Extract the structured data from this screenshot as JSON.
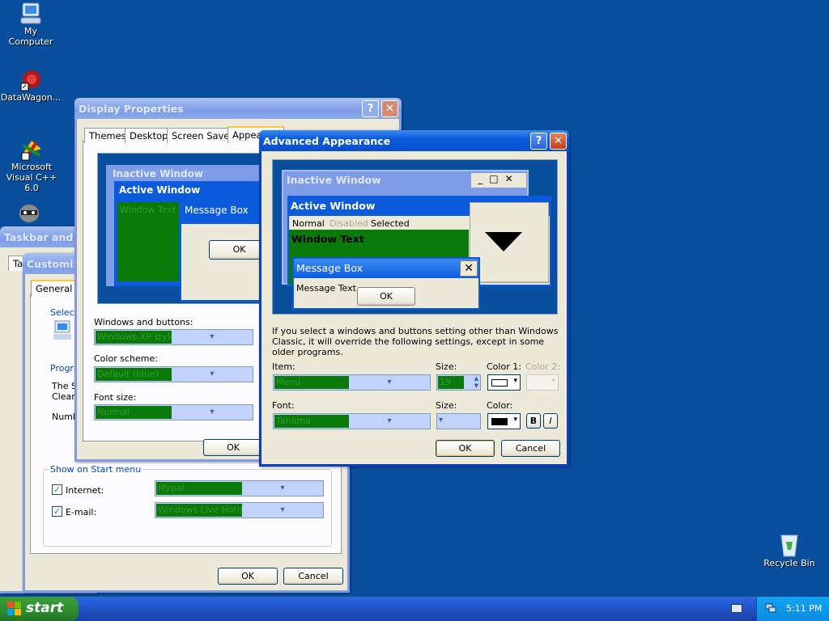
{
  "desktop": {
    "icons": [
      {
        "label": "My Computer",
        "icon": "computer-icon"
      },
      {
        "label": "DataWagon...",
        "icon": "datawagon-icon"
      },
      {
        "label": "Microsoft Visual C++ 6.0",
        "icon": "visual-cpp-icon"
      },
      {
        "label": "",
        "icon": "raccoon-icon"
      },
      {
        "label": "Recycle Bin",
        "icon": "recycle-bin-icon"
      }
    ]
  },
  "taskbar_props": {
    "title": "Taskbar and S",
    "tab": "Ta"
  },
  "customize": {
    "title": "Customiz",
    "tab_general": "General",
    "select_label": "Select",
    "programs_label": "Progra",
    "programs_text_1": "The S",
    "programs_text_2": "Clearir",
    "number_label": "Numb",
    "show_on_start": "Show on Start menu",
    "internet_label": "Internet:",
    "internet_value": "Mypal",
    "email_label": "E-mail:",
    "email_value": "Windows Live Hotmai",
    "ok": "OK",
    "cancel": "Cancel"
  },
  "display": {
    "title": "Display Properties",
    "tabs": [
      "Themes",
      "Desktop",
      "Screen Saver",
      "Appea"
    ],
    "preview": {
      "inactive": "Inactive Window",
      "active": "Active Window",
      "window_text": "Window Text",
      "message_box": "Message Box",
      "ok": "OK"
    },
    "windows_buttons_label": "Windows and buttons:",
    "windows_buttons_value": "Windows XP style",
    "color_scheme_label": "Color scheme:",
    "color_scheme_value": "Default (blue)",
    "font_size_label": "Font size:",
    "font_size_value": "Normal",
    "ok": "OK"
  },
  "advanced": {
    "title": "Advanced Appearance",
    "preview": {
      "inactive": "Inactive Window",
      "active": "Active Window",
      "menu_normal": "Normal",
      "menu_disabled": "Disabled",
      "menu_selected": "Selected",
      "window_text": "Window Text",
      "message_box": "Message Box",
      "message_text": "Message Text",
      "ok": "OK"
    },
    "info": "If you select a windows and buttons setting other than Windows Classic, it will override the following settings, except in some older programs.",
    "item_label": "Item:",
    "item_value": "Menu",
    "size_label": "Size:",
    "size_value": "19",
    "color1_label": "Color 1:",
    "color2_label": "Color 2:",
    "font_label": "Font:",
    "font_value": "Tahoma",
    "size2_label": "Size:",
    "color_label": "Color:",
    "bold": "B",
    "italic": "I",
    "ok": "OK",
    "cancel": "Cancel"
  },
  "taskbar": {
    "start": "start",
    "clock": "5:11 PM"
  },
  "colors": {
    "desktop": "#0a4f9e",
    "accent": "#0a7a0a"
  }
}
